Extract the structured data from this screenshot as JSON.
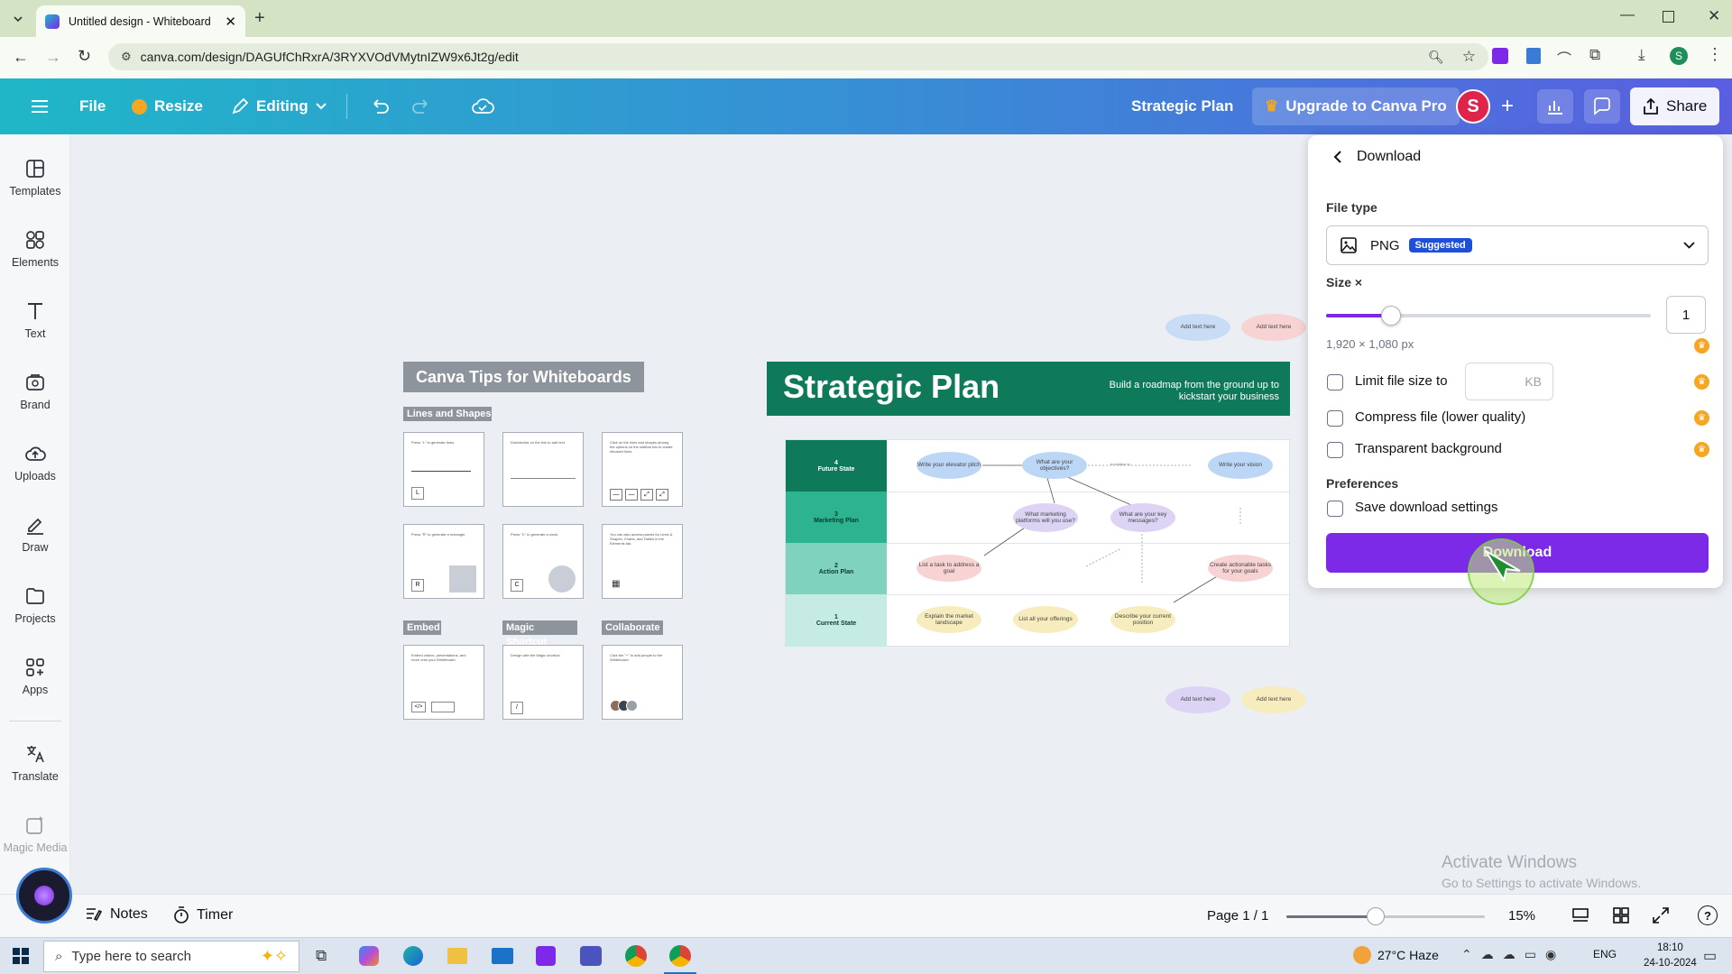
{
  "browser": {
    "tab_title": "Untitled design - Whiteboard",
    "url": "canva.com/design/DAGUfChRxrA/3RYXVOdVMytnIZW9x6Jt2g/edit"
  },
  "header": {
    "file": "File",
    "resize": "Resize",
    "editing": "Editing",
    "design_title": "Strategic Plan",
    "upgrade": "Upgrade to Canva Pro",
    "avatar_letter": "S",
    "share": "Share"
  },
  "sidebar": {
    "items": [
      {
        "label": "Templates",
        "icon": "templates-icon"
      },
      {
        "label": "Elements",
        "icon": "elements-icon"
      },
      {
        "label": "Text",
        "icon": "text-icon"
      },
      {
        "label": "Brand",
        "icon": "brand-icon"
      },
      {
        "label": "Uploads",
        "icon": "uploads-icon"
      },
      {
        "label": "Draw",
        "icon": "draw-icon"
      },
      {
        "label": "Projects",
        "icon": "projects-icon"
      },
      {
        "label": "Apps",
        "icon": "apps-icon"
      },
      {
        "label": "Translate",
        "icon": "translate-icon"
      },
      {
        "label": "Magic Media",
        "icon": "magic-media-icon"
      }
    ]
  },
  "tips": {
    "title": "Canva Tips for Whiteboards",
    "lines_shapes": "Lines and Shapes",
    "embed": "Embed",
    "magic_shortcut": "Magic Shortcut",
    "collaborate": "Collaborate",
    "tile_texts": [
      "Press \"L\" to generate lines.",
      "Doubleclick on the line to add text.",
      "Click on the lines and shapes among the options on the sidebar bar to create elbowed lines.",
      "Press \"R\" to generate a rectangle.",
      "Press \"C\" to generate a circle.",
      "You can also access panels for Lines & Shapes, Charts, and Tables in the Elements tab.",
      "Embed videos, presentations, and more onto your Whiteboard.",
      "Design with the Magic shortcut.",
      "Click the \"+\" to add people to the Whiteboard."
    ],
    "tile_keys": [
      "L",
      "R",
      "C",
      "/"
    ]
  },
  "board": {
    "title": "Strategic Plan",
    "subtitle": "Build a roadmap from the ground up to kickstart your business",
    "top_chips": [
      "Add text here",
      "Add text here"
    ],
    "bottom_chips": [
      "Add text here",
      "Add text here"
    ],
    "rows": [
      {
        "num": "4",
        "label": "Future State"
      },
      {
        "num": "3",
        "label": "Marketing Plan"
      },
      {
        "num": "2",
        "label": "Action Plan"
      },
      {
        "num": "1",
        "label": "Current State"
      }
    ],
    "bubbles": {
      "b1": "Write your elevator pitch",
      "b2": "What are your objectives?",
      "b3": "Write your vision",
      "b4": "What marketing platforms will you use?",
      "b5": "What are your key messages?",
      "b6": "List a task to address a goal",
      "b7": "Create actionable tasks for your goals",
      "b8": "Explain the market landscape",
      "b9": "List all your offerings",
      "b10": "Describe your current position"
    },
    "line_note": "in relation to"
  },
  "download_panel": {
    "title": "Download",
    "file_type_label": "File type",
    "file_type": "PNG",
    "suggested": "Suggested",
    "size_label": "Size ×",
    "size_value": "1",
    "size_fraction": 0.2,
    "dimensions": "1,920 × 1,080 px",
    "limit_label": "Limit file size to",
    "kb": "KB",
    "compress_label": "Compress file (lower quality)",
    "transparent_label": "Transparent background",
    "preferences": "Preferences",
    "save_settings": "Save download settings",
    "download_button": "Download"
  },
  "watermark": {
    "line1": "Activate Windows",
    "line2": "Go to Settings to activate Windows."
  },
  "bottom_bar": {
    "notes": "Notes",
    "timer": "Timer",
    "page": "Page 1 / 1",
    "zoom": "15%",
    "zoom_fraction": 0.45
  },
  "taskbar": {
    "search_placeholder": "Type here to search",
    "weather": "27°C  Haze",
    "lang": "ENG",
    "time": "18:10",
    "date": "24-10-2024"
  },
  "colors": {
    "brand_purple": "#7d2ae8",
    "board_green": "#0f7a5a",
    "header_start": "#1fb7c8",
    "header_end": "#5a5ee0"
  }
}
